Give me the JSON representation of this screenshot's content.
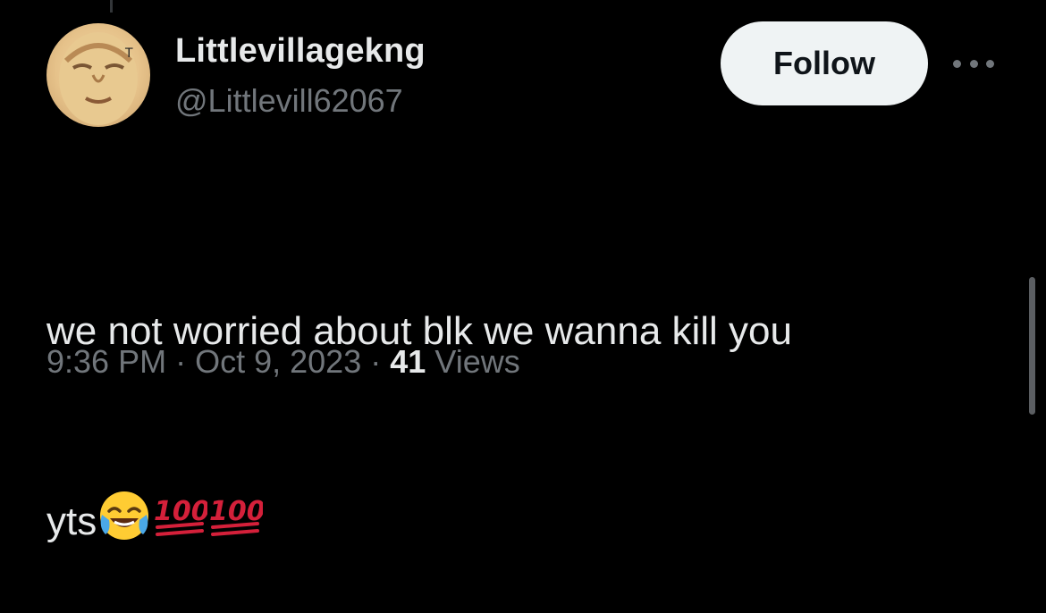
{
  "user": {
    "display_name": "Littlevillagekng",
    "handle": "@Littlevill62067",
    "follow_label": "Follow"
  },
  "tweet": {
    "text_line1": "we not worried about blk we wanna kill you",
    "text_line2": "yts",
    "emojis": [
      "face-with-tears-of-joy-emoji",
      "hundred-points-emoji",
      "hundred-points-emoji"
    ]
  },
  "meta": {
    "time": "9:36 PM",
    "separator": "·",
    "date": "Oct 9, 2023",
    "views_count": "41",
    "views_label": "Views"
  },
  "colors": {
    "background": "#000000",
    "primary_text": "#e7e9ea",
    "secondary_text": "#71767b",
    "follow_bg": "#eff3f4",
    "hundred_red": "#d4203a"
  }
}
